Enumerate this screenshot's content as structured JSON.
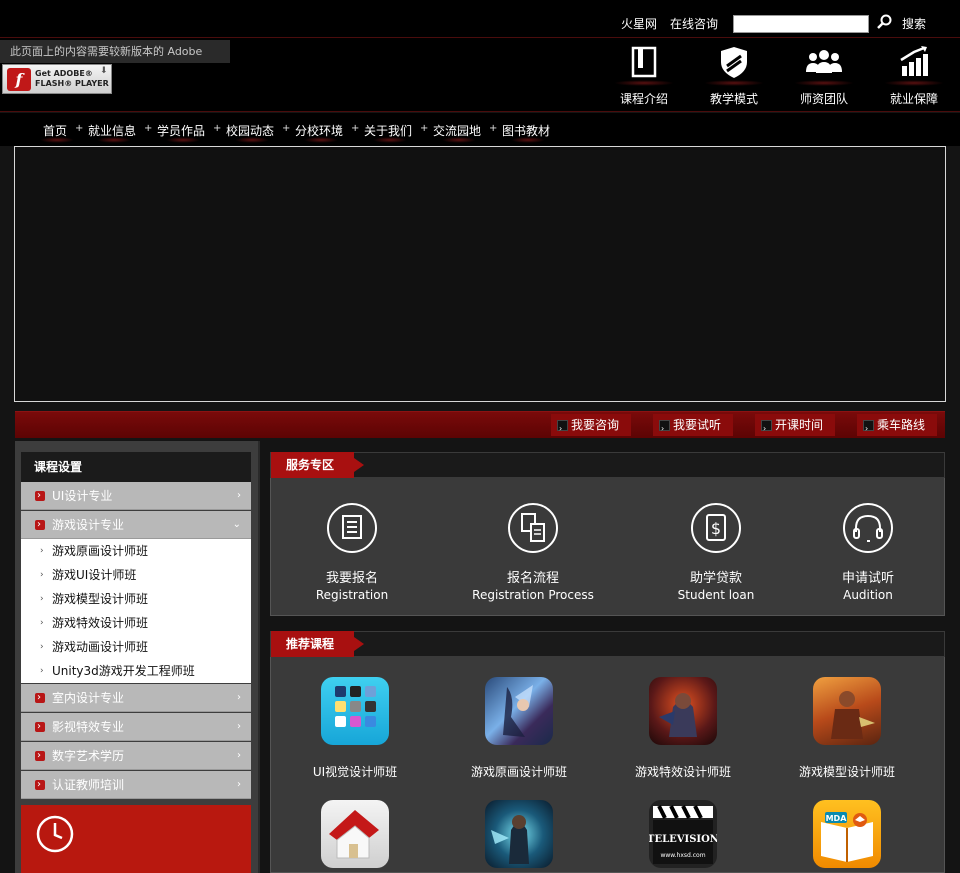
{
  "top": {
    "links": [
      "火星网",
      "在线咨询"
    ],
    "search_placeholder": "",
    "search_label": "搜索"
  },
  "flash": {
    "notice": "此页面上的内容需要较新版本的 Adobe",
    "get_line1": "Get ADOBE®",
    "get_line2": "FLASH® PLAYER"
  },
  "features": [
    "课程介绍",
    "教学模式",
    "师资团队",
    "就业保障"
  ],
  "nav": [
    "首页",
    "就业信息",
    "学员作品",
    "校园动态",
    "分校环境",
    "关于我们",
    "交流园地",
    "图书教材"
  ],
  "strip": [
    "我要咨询",
    "我要试听",
    "开课时间",
    "乘车路线"
  ],
  "sidebar": {
    "title": "课程设置",
    "categories": [
      "UI设计专业",
      "游戏设计专业",
      "室内设计专业",
      "影视特效专业",
      "数字艺术学历",
      "认证教师培训"
    ],
    "subitems": [
      "游戏原画设计师班",
      "游戏UI设计师班",
      "游戏模型设计师班",
      "游戏特效设计师班",
      "游戏动画设计师班",
      "Unity3d游戏开发工程师班"
    ]
  },
  "services": {
    "title": "服务专区",
    "items": [
      {
        "cn": "我要报名",
        "en": "Registration"
      },
      {
        "cn": "报名流程",
        "en": "Registration Process"
      },
      {
        "cn": "助学贷款",
        "en": "Student loan"
      },
      {
        "cn": "申请试听",
        "en": "Audition"
      }
    ]
  },
  "courses": {
    "title": "推荐课程",
    "items": [
      "UI视觉设计师班",
      "游戏原画设计师班",
      "游戏特效设计师班",
      "游戏模型设计师班"
    ],
    "tv_text": "TELEVISION",
    "tv_url": "www.hxsd.com",
    "mda_text": "MDA"
  },
  "colors": {
    "accent": "#a81010",
    "strip": "#7a0a0a",
    "clock_box": "#b8180f"
  }
}
